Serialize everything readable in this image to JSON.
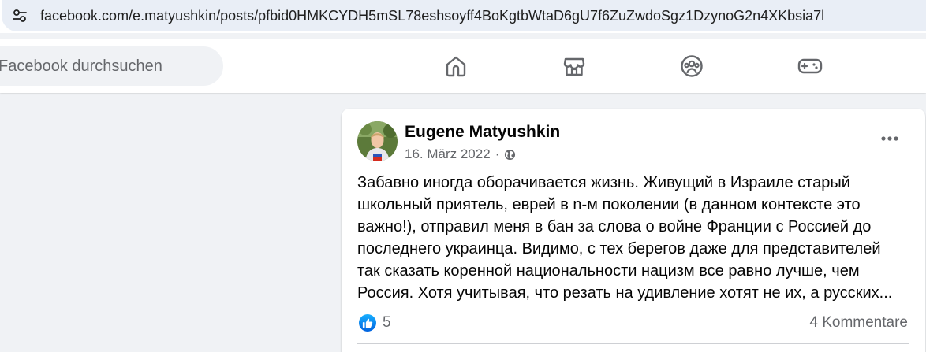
{
  "browser": {
    "url": "facebook.com/e.matyushkin/posts/pfbid0HMKCYDH5mSL78eshsoyff4BoKgtbWtaD6gU7f6ZuZwdoSgz1DzynoG2n4XKbsia7l",
    "site_info_icon": "tune-icon"
  },
  "header": {
    "search_placeholder": "Facebook durchsuchen",
    "nav_icons": [
      "home-icon",
      "marketplace-icon",
      "groups-icon",
      "gaming-icon"
    ],
    "nav_icon_color": "#65676b"
  },
  "post": {
    "author": "Eugene Matyushkin",
    "date": "16. März 2022",
    "separator": "·",
    "privacy_icon": "globe-icon",
    "text": "Забавно иногда оборачивается жизнь. Живущий в Израиле старый\nшкольный приятель, еврей в n-м поколении (в данном контексте это\nважно!), отправил меня в бан за слова о войне Франции с Россией до\nпоследнего украинца. Видимо, с тех берегов даже для представителей\nтак сказать коренной национальности нацизм все равно лучше, чем\nРоссия. Хотя учитывая, что резать на удивление хотят не их, а русских...",
    "reactions_count": "5",
    "comments_label": "4 Kommentare"
  },
  "colors": {
    "page_bg": "#f0f2f5",
    "like_blue": "#0866ff",
    "secondary_text": "#65676b"
  }
}
